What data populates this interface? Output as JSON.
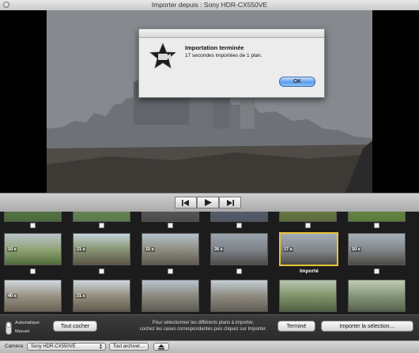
{
  "window": {
    "title": "Importer depuis : Sony HDR-CX550VE"
  },
  "dialog": {
    "app_icon": "imovie-star-icon",
    "heading": "Importation terminée",
    "message": "17 secondes importées de 1 plan.",
    "ok_label": "OK"
  },
  "transport": {
    "prev_icon": "skip-back-icon",
    "play_icon": "play-icon",
    "next_icon": "skip-forward-icon"
  },
  "clips": {
    "row2": [
      {
        "duration": "10 s",
        "checked": false,
        "imported": false
      },
      {
        "duration": "21 s",
        "checked": false,
        "imported": false
      },
      {
        "duration": "15 s",
        "checked": false,
        "imported": false
      },
      {
        "duration": "26 s",
        "checked": false,
        "imported": false
      },
      {
        "duration": "17 s",
        "checked": false,
        "imported": true,
        "status": "Importé"
      },
      {
        "duration": "10 s",
        "checked": false,
        "imported": false
      }
    ],
    "row3": [
      {
        "duration": "40 s"
      },
      {
        "duration": "21 s"
      },
      {
        "duration": ""
      },
      {
        "duration": ""
      },
      {
        "duration": ""
      },
      {
        "duration": ""
      }
    ]
  },
  "footer": {
    "mode_auto": "Automatique",
    "mode_manual": "Manuel",
    "check_all": "Tout cocher",
    "hint_line1": "Pour sélectionner les différents plans à importer,",
    "hint_line2": "cochez les cases correspondantes puis cliquez sur Importer.",
    "done": "Terminé",
    "import_selection": "Importer la sélection…"
  },
  "statusbar": {
    "camera_label": "Caméra",
    "camera_value": "Sony HDR-CX550VE",
    "archive_all": "Tout archiver…",
    "eject_icon": "eject-icon"
  },
  "colors": {
    "selection": "#e8c23a",
    "ok_button": "#5c9de8"
  }
}
